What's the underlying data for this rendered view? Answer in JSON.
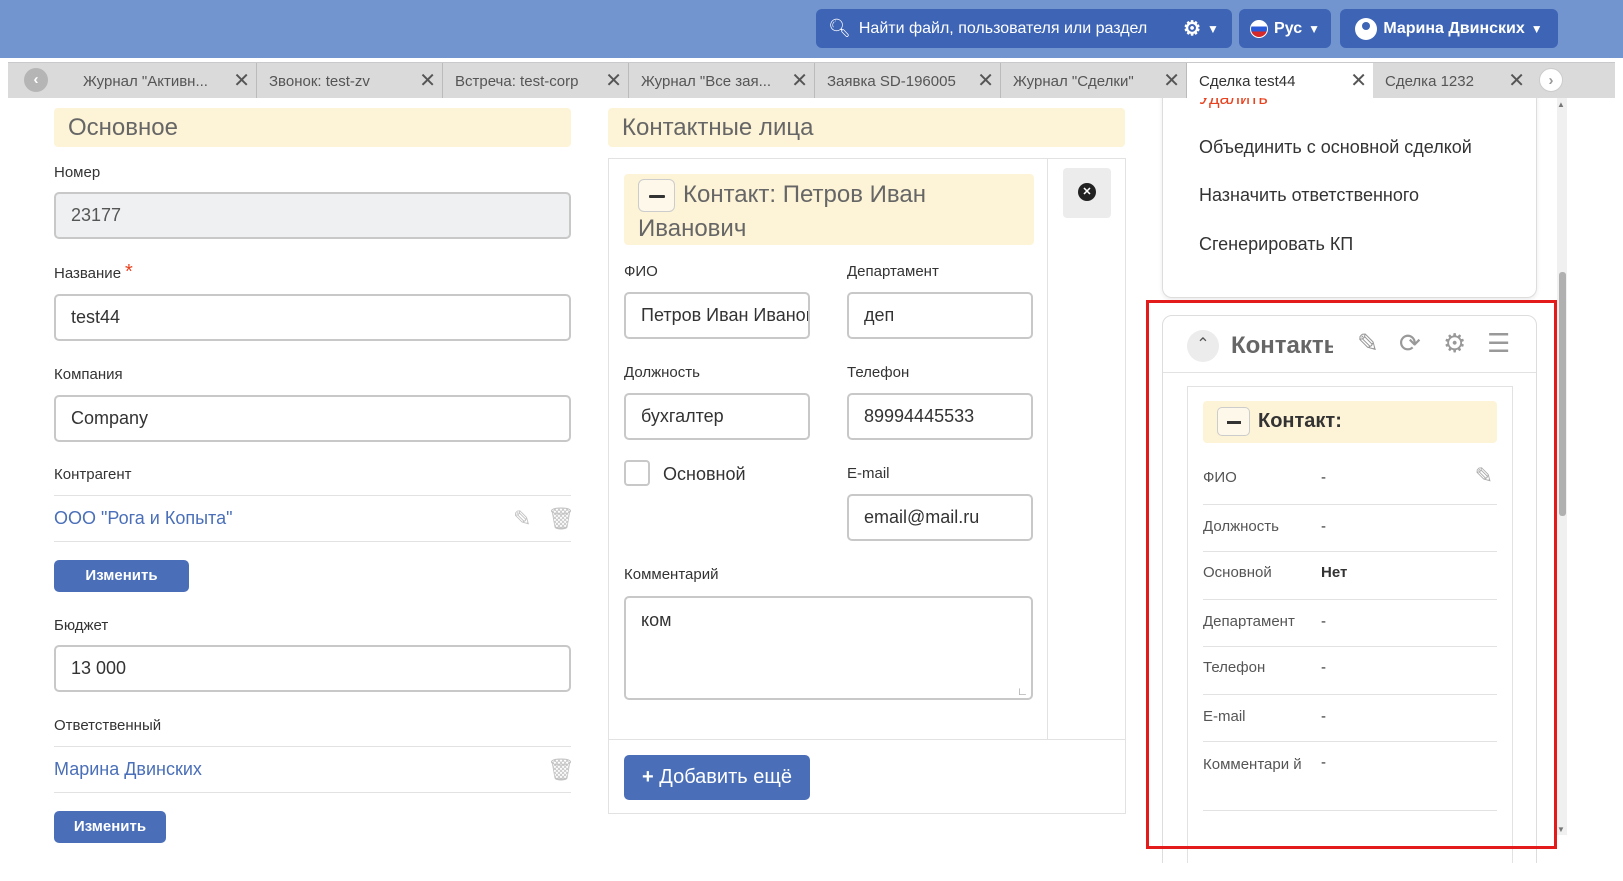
{
  "topbar": {
    "search_placeholder": "Найти файл, пользователя или раздел",
    "lang_label": "Рус",
    "user_name": "Марина Двинских"
  },
  "tabs": [
    {
      "label": "Журнал \"Активн..."
    },
    {
      "label": "Звонок: test-zv"
    },
    {
      "label": "Встреча: test-corp"
    },
    {
      "label": "Журнал \"Все зая..."
    },
    {
      "label": "Заявка SD-196005"
    },
    {
      "label": "Журнал \"Сделки\""
    },
    {
      "label": "Сделка test44"
    },
    {
      "label": "Сделка 1232"
    }
  ],
  "main": {
    "section_title": "Основное",
    "number_label": "Номер",
    "number_value": "23177",
    "name_label": "Название",
    "name_value": "test44",
    "company_label": "Компания",
    "company_value": "Company",
    "counterparty_label": "Контрагент",
    "counterparty_value": "ООО \"Рога и Копыта\"",
    "change_label": "Изменить",
    "budget_label": "Бюджет",
    "budget_value": "13 000",
    "responsible_label": "Ответственный",
    "responsible_value": "Марина Двинских",
    "change_label2": "Изменить"
  },
  "contacts": {
    "section_title": "Контактные лица",
    "card_title": "Контакт: Петров Иван Иванович",
    "fio_label": "ФИО",
    "fio_value": "Петров Иван Иванович",
    "dept_label": "Департамент",
    "dept_value": "деп",
    "position_label": "Должность",
    "position_value": "бухгалтер",
    "phone_label": "Телефон",
    "phone_value": "89994445533",
    "primary_label": "Основной",
    "email_label": "E-mail",
    "email_value": "email@mail.ru",
    "comment_label": "Комментарий",
    "comment_value": "ком",
    "add_more_label": "Добавить ещё"
  },
  "actions_menu": {
    "delete": "Удалить",
    "merge": "Объединить с основной сделкой",
    "assign": "Назначить ответственного",
    "generate": "Сгенерировать КП"
  },
  "widget": {
    "title": "Контакты",
    "card_title": "Контакт:",
    "rows": [
      {
        "key": "ФИО",
        "value": "-"
      },
      {
        "key": "Должность",
        "value": "-"
      },
      {
        "key": "Основной",
        "value": "Нет"
      },
      {
        "key": "Департамент",
        "value": "-"
      },
      {
        "key": "Телефон",
        "value": "-"
      },
      {
        "key": "E-mail",
        "value": "-"
      },
      {
        "key": "Комментари й",
        "value": "-"
      }
    ]
  },
  "colors": {
    "topbar": "#7294cf",
    "button_blue": "#4a6fb8",
    "header_cream": "#fdf3d7",
    "danger": "#e8421f",
    "highlight_border": "#e31b1b"
  }
}
